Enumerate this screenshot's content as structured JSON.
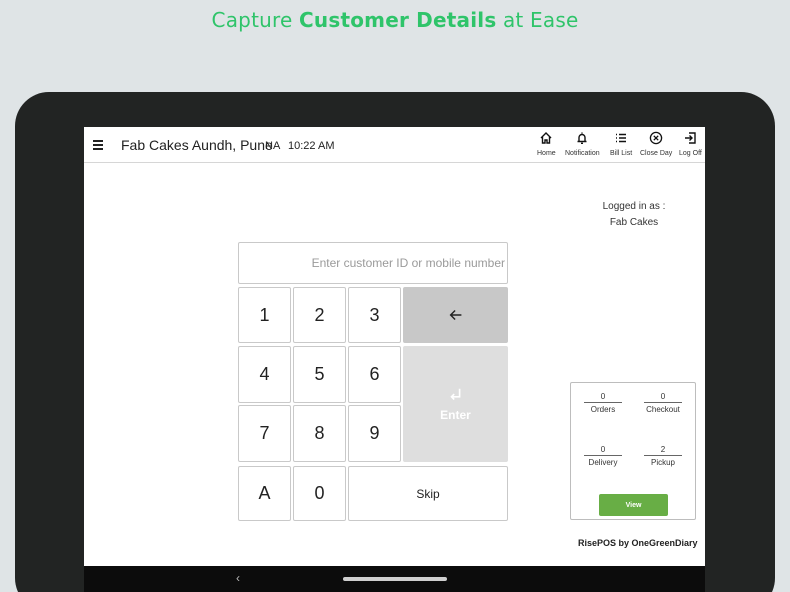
{
  "headline": {
    "part1": "Capture ",
    "bold": "Customer Details",
    "part2": " at Ease"
  },
  "topbar": {
    "store_name": "Fab Cakes Aundh, Pune",
    "status": "NA",
    "time": "10:22 AM",
    "nav": [
      {
        "label": "Home",
        "icon": "home-icon"
      },
      {
        "label": "Notification",
        "icon": "bell-icon"
      },
      {
        "label": "Bill List",
        "icon": "list-icon"
      },
      {
        "label": "Close Day",
        "icon": "close-circle-icon"
      },
      {
        "label": "Log Off",
        "icon": "logout-icon"
      }
    ]
  },
  "logged_in": {
    "line1": "Logged in as :",
    "line2": "Fab Cakes"
  },
  "customer_input": {
    "placeholder": "Enter customer ID or mobile number",
    "value": ""
  },
  "keypad": {
    "keys": [
      "1",
      "2",
      "3",
      "4",
      "5",
      "6",
      "7",
      "8",
      "9",
      "A",
      "0"
    ],
    "skip": "Skip",
    "enter": "Enter",
    "backspace_icon": "arrow-left-icon",
    "enter_icon": "return-icon"
  },
  "stats": {
    "orders": {
      "value": "0",
      "label": "Orders"
    },
    "checkout": {
      "value": "0",
      "label": "Checkout"
    },
    "delivery": {
      "value": "0",
      "label": "Delivery"
    },
    "pickup": {
      "value": "2",
      "label": "Pickup"
    },
    "view_label": "View"
  },
  "brand": "RisePOS by OneGreenDiary",
  "colors": {
    "accent_green": "#2fc46a",
    "view_button": "#68ae45",
    "bezel": "#222423"
  }
}
